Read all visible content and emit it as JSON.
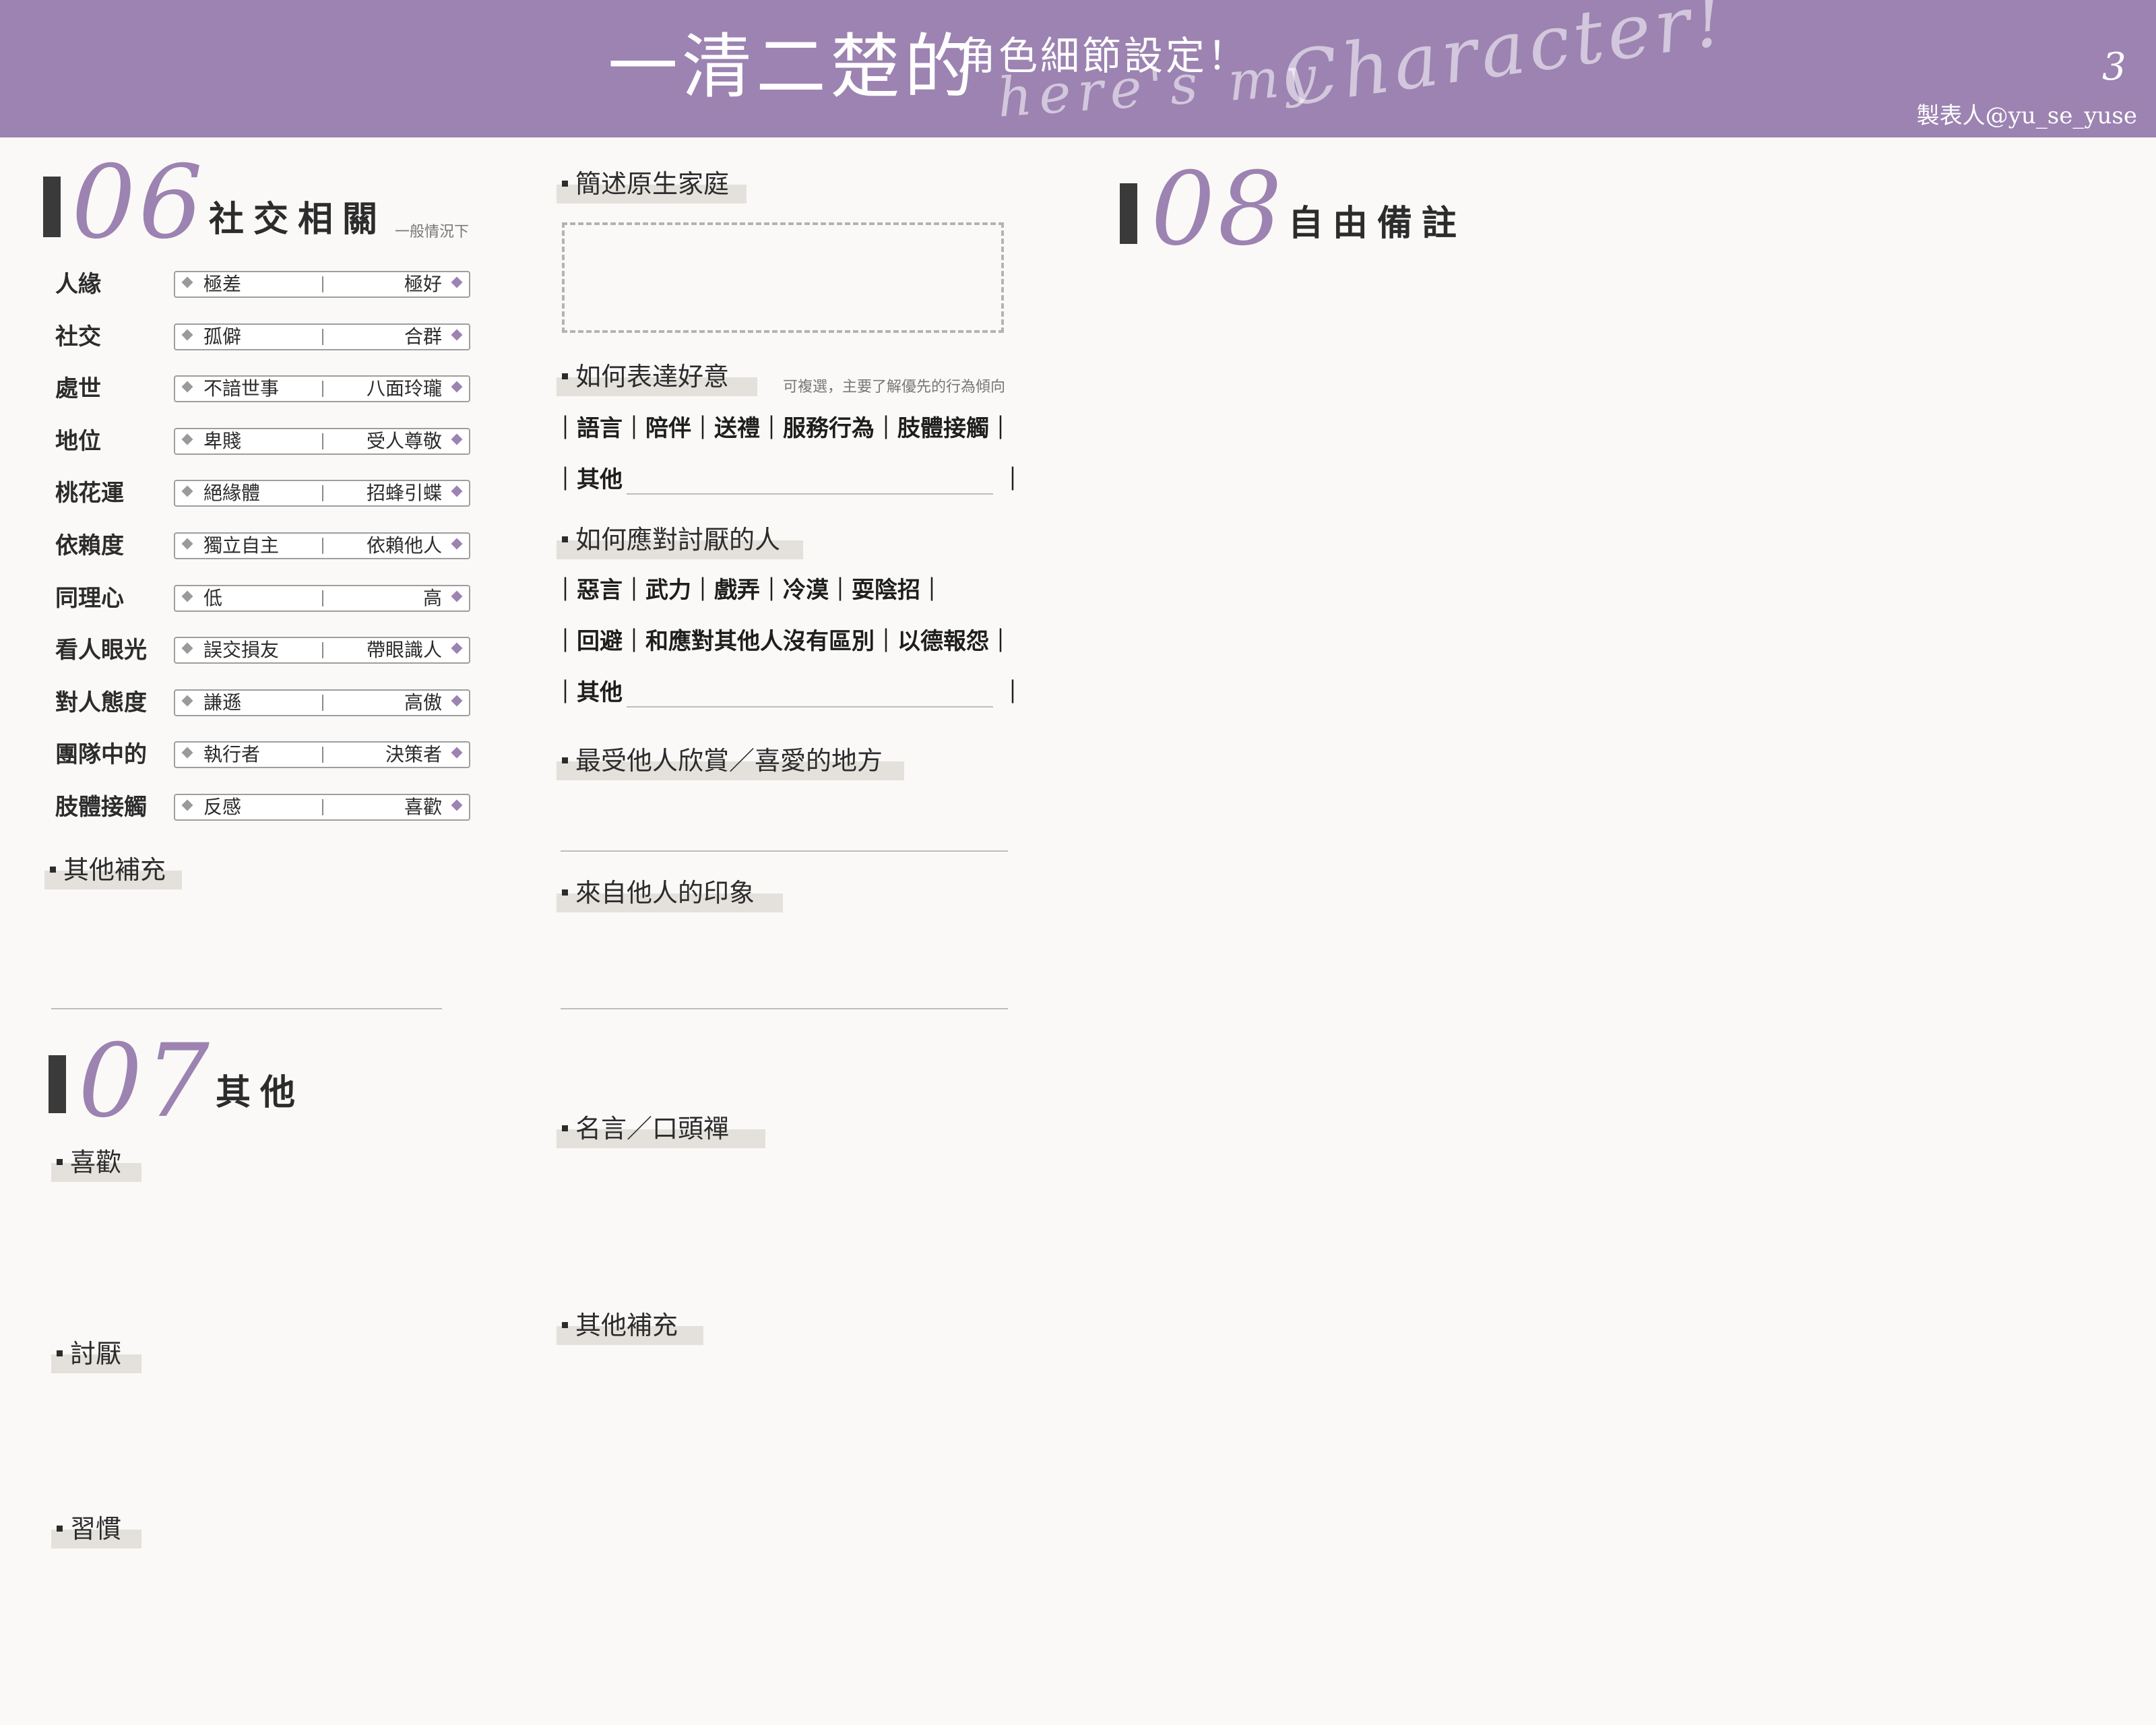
{
  "header": {
    "title_main": "一清二楚的",
    "title_sub": "角色細節設定！",
    "script_left": "here's my",
    "script_right": "Character!",
    "page_number": "3",
    "credit": "製表人@yu_se_yuse",
    "bg_color": "#9c83b1"
  },
  "section06": {
    "number": "06",
    "title": "社交相關",
    "note": "一般情況下",
    "rows": [
      {
        "label": "人緣",
        "left": "極差",
        "right": "極好"
      },
      {
        "label": "社交",
        "left": "孤僻",
        "right": "合群"
      },
      {
        "label": "處世",
        "left": "不諳世事",
        "right": "八面玲瓏"
      },
      {
        "label": "地位",
        "left": "卑賤",
        "right": "受人尊敬"
      },
      {
        "label": "桃花運",
        "left": "絕緣體",
        "right": "招蜂引蝶"
      },
      {
        "label": "依賴度",
        "left": "獨立自主",
        "right": "依賴他人"
      },
      {
        "label": "同理心",
        "left": "低",
        "right": "高"
      },
      {
        "label": "看人眼光",
        "left": "誤交損友",
        "right": "帶眼識人"
      },
      {
        "label": "對人態度",
        "left": "謙遜",
        "right": "高傲"
      },
      {
        "label": "團隊中的",
        "left": "執行者",
        "right": "決策者"
      },
      {
        "label": "肢體接觸",
        "left": "反感",
        "right": "喜歡"
      }
    ],
    "extra_label": "其他補充"
  },
  "section07": {
    "number": "07",
    "title": "其他",
    "likes_label": "喜歡",
    "dislikes_label": "討厭",
    "habits_label": "習慣"
  },
  "middle": {
    "family_label": "簡述原生家庭",
    "affection_label": "如何表達好意",
    "affection_note": "可複選，主要了解優先的行為傾向",
    "affection_options": "｜語言｜陪伴｜送禮｜服務行為｜肢體接觸｜",
    "affection_other": "｜其他",
    "hate_label": "如何應對討厭的人",
    "hate_options_1": "｜惡言｜武力｜戲弄｜冷漠｜耍陰招｜",
    "hate_options_2": "｜回避｜和應對其他人沒有區別｜以德報怨｜",
    "hate_other": "｜其他",
    "other_end_bar": "｜",
    "appreciated_label": "最受他人欣賞／喜愛的地方",
    "impression_label": "來自他人的印象",
    "quote_label": "名言／口頭禪",
    "extra_label": "其他補充"
  },
  "section08": {
    "number": "08",
    "title": "自由備註"
  }
}
